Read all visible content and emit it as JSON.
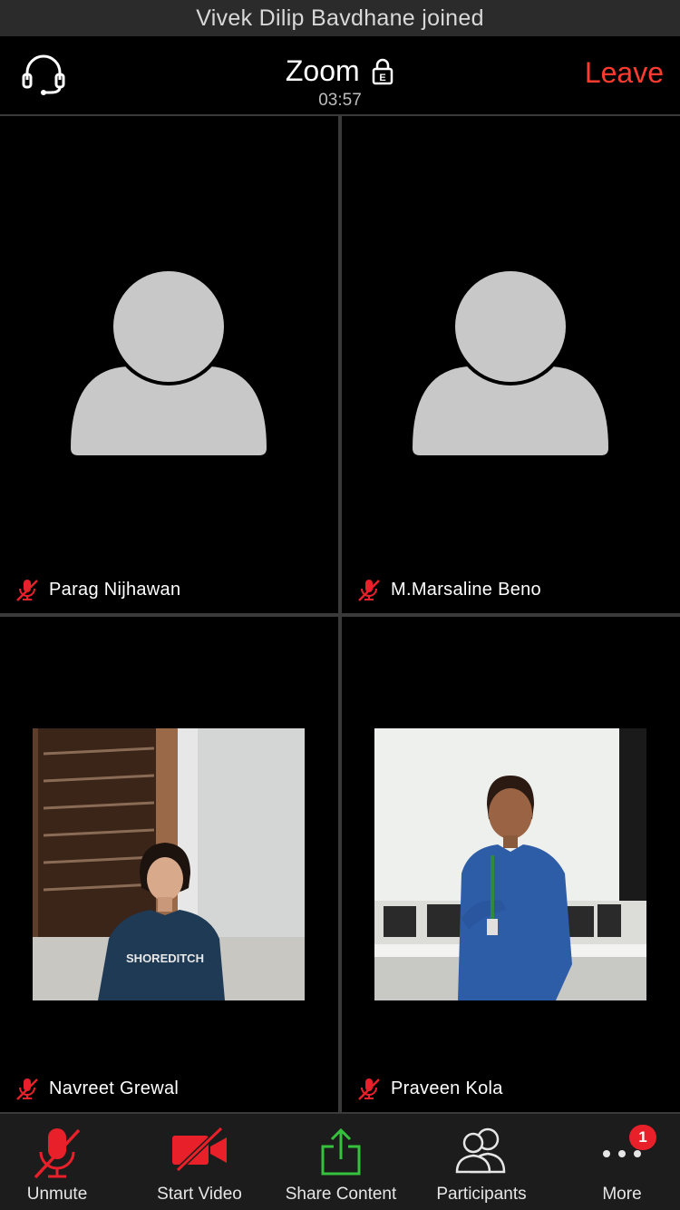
{
  "notification": "Vivek Dilip Bavdhane joined",
  "header": {
    "title": "Zoom",
    "lock_letter": "E",
    "timer": "03:57",
    "leave_label": "Leave"
  },
  "participants": [
    {
      "name": "Parag Nijhawan",
      "muted": true,
      "video": false
    },
    {
      "name": "M.Marsaline Beno",
      "muted": true,
      "video": false
    },
    {
      "name": "Navreet Grewal",
      "muted": true,
      "video": true
    },
    {
      "name": "Praveen Kola",
      "muted": true,
      "video": true
    }
  ],
  "video_text": {
    "shirt": "SHOREDITCH"
  },
  "toolbar": {
    "unmute": "Unmute",
    "start_video": "Start Video",
    "share_content": "Share Content",
    "participants": "Participants",
    "more": "More",
    "more_badge": "1"
  },
  "colors": {
    "accent_red": "#ff3b30",
    "share_green": "#35c23c",
    "background": "#000000"
  }
}
